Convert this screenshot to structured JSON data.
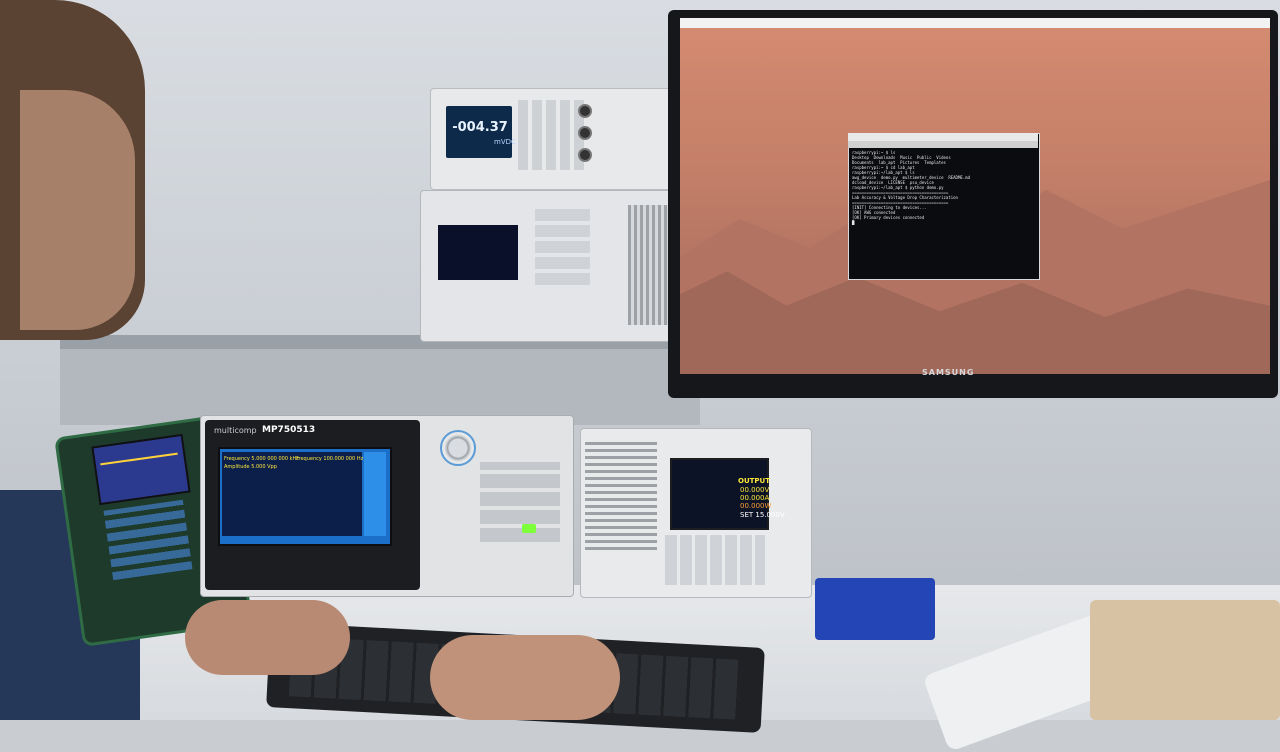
{
  "dmm": {
    "reading": "-004.37",
    "unit": "mVDC"
  },
  "awg": {
    "brand": "multicomp",
    "model": "MP750513",
    "ch1_freq": "Frequency 5.000 000 000 kHz",
    "ch1_amp": "Amplitude 5.000 Vpp",
    "ch2_freq": "Frequency 100.000 000 Hz"
  },
  "power_supply": {
    "output_label": "OUTPUT",
    "volts": "00.000V",
    "amps": "00.000A",
    "watts": "00.000W",
    "set_label": "SET 15.000V"
  },
  "monitor": {
    "brand": "SAMSUNG",
    "terminal_lines": "raspberrypi:~ $ ls\nDesktop  Downloads  Music  Public  Videos\nDocuments  lab_apt  Pictures  Templates\nraspberrypi:~ $ cd lab_apt\nraspberrypi:~/lab_apt $ ls\nawg_device  demo.py  multimeter_device  README.md\ndcload_device  LICENSE  psu_device\nraspberrypi:~/lab_apt $ python demo.py\n========================================\nLab Accuracy & Voltage Drop Characterization\n========================================\n[INIT] Connecting to devices...\n[OK] AWG connected\n[OK] Primary devices connected\n█"
  }
}
